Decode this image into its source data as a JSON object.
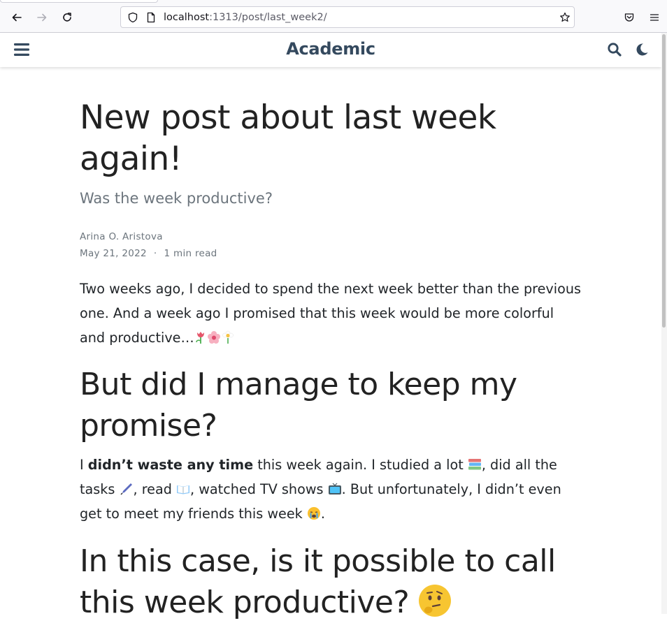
{
  "browser": {
    "url_host": "localhost",
    "url_rest": ":1313/post/last_week2/",
    "icons": {
      "back": "arrow-left-icon",
      "forward": "arrow-right-icon",
      "reload": "reload-icon",
      "shield": "shield-icon",
      "page": "page-icon",
      "bookmark": "star-icon",
      "pocket": "pocket-icon",
      "menu": "hamburger-icon"
    }
  },
  "site": {
    "title": "Academic",
    "icons": {
      "menu": "hamburger-icon",
      "search": "search-icon",
      "theme": "moon-icon"
    },
    "brand_color": "#34495e"
  },
  "post": {
    "title": "New post about last week again!",
    "subtitle": "Was the week productive?",
    "author": "Arina O. Aristova",
    "date": "May 21, 2022",
    "separator": "·",
    "reading_time": "1 min read",
    "p1": "Two weeks ago, I decided to spend the next week better than the previous one. And a week ago I promised that this week would be more colorful and productive…",
    "h2_1": "But did I manage to keep my promise?",
    "p2": {
      "part1": "I ",
      "bold": "didn’t waste any time",
      "part2": " this week again. I studied a lot ",
      "part3": ", did all the tasks ",
      "part4": ", read ",
      "part5": ", watched TV shows ",
      "part6": ". But unfortunately, I didn’t even get to meet my friends this week ",
      "part7": "."
    },
    "h2_2": "In this case, is it possible to call this week productive?"
  }
}
